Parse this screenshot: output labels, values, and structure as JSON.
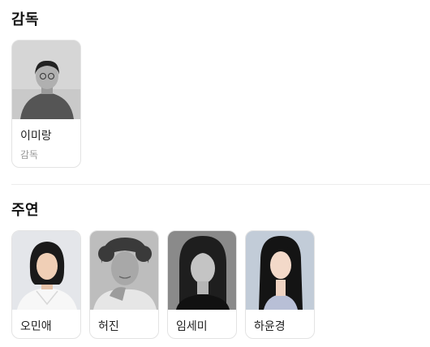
{
  "director_section": {
    "title": "감독",
    "people": [
      {
        "name": "이미랑",
        "role": "감독",
        "photo": "director-portrait-grayscale"
      }
    ]
  },
  "cast_section": {
    "title": "주연",
    "people": [
      {
        "name": "오민애",
        "photo": "actor-portrait-color"
      },
      {
        "name": "허진",
        "photo": "actor-portrait-grayscale"
      },
      {
        "name": "임세미",
        "photo": "actor-portrait-grayscale"
      },
      {
        "name": "하윤경",
        "photo": "actor-portrait-color"
      }
    ]
  }
}
